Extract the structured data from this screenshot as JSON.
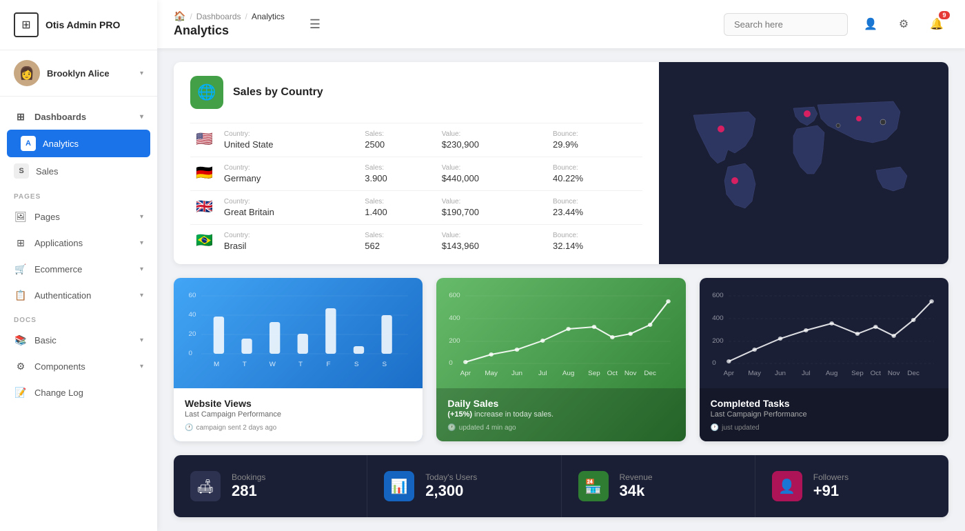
{
  "sidebar": {
    "logo_text": "Otis Admin PRO",
    "user_name": "Brooklyn Alice",
    "nav": {
      "dashboards_label": "Dashboards",
      "analytics_label": "Analytics",
      "analytics_letter": "A",
      "sales_label": "Sales",
      "sales_letter": "S",
      "pages_section": "PAGES",
      "pages_label": "Pages",
      "applications_label": "Applications",
      "ecommerce_label": "Ecommerce",
      "authentication_label": "Authentication",
      "docs_section": "DOCS",
      "basic_label": "Basic",
      "components_label": "Components",
      "changelog_label": "Change Log"
    }
  },
  "header": {
    "home_icon": "🏠",
    "breadcrumb_sep1": "/",
    "breadcrumb_dashboards": "Dashboards",
    "breadcrumb_sep2": "/",
    "breadcrumb_current": "Analytics",
    "page_title": "Analytics",
    "search_placeholder": "Search here",
    "notif_count": "9"
  },
  "sales_by_country": {
    "title": "Sales by Country",
    "columns": {
      "country": "Country:",
      "sales": "Sales:",
      "value": "Value:",
      "bounce": "Bounce:"
    },
    "rows": [
      {
        "flag": "🇺🇸",
        "country": "United State",
        "sales": "2500",
        "value": "$230,900",
        "bounce": "29.9%"
      },
      {
        "flag": "🇩🇪",
        "country": "Germany",
        "sales": "3.900",
        "value": "$440,000",
        "bounce": "40.22%"
      },
      {
        "flag": "🇬🇧",
        "country": "Great Britain",
        "sales": "1.400",
        "value": "$190,700",
        "bounce": "23.44%"
      },
      {
        "flag": "🇧🇷",
        "country": "Brasil",
        "sales": "562",
        "value": "$143,960",
        "bounce": "32.14%"
      }
    ]
  },
  "website_views": {
    "title": "Website Views",
    "subtitle": "Last Campaign Performance",
    "footer": "campaign sent 2 days ago",
    "bars": [
      40,
      15,
      35,
      20,
      55,
      10,
      45
    ],
    "labels": [
      "M",
      "T",
      "W",
      "T",
      "F",
      "S",
      "S"
    ],
    "y_labels": [
      "0",
      "20",
      "40",
      "60"
    ]
  },
  "daily_sales": {
    "title": "Daily Sales",
    "highlight": "(+15%)",
    "subtitle": " increase in today sales.",
    "footer": "updated 4 min ago",
    "data": [
      10,
      50,
      120,
      200,
      280,
      320,
      200,
      250,
      310,
      480
    ],
    "labels": [
      "Apr",
      "May",
      "Jun",
      "Jul",
      "Aug",
      "Sep",
      "Oct",
      "Nov",
      "Dec"
    ],
    "y_labels": [
      "0",
      "200",
      "400",
      "600"
    ]
  },
  "completed_tasks": {
    "title": "Completed Tasks",
    "subtitle": "Last Campaign Performance",
    "footer": "just updated",
    "data": [
      20,
      80,
      180,
      280,
      400,
      280,
      320,
      260,
      360,
      460
    ],
    "labels": [
      "Apr",
      "May",
      "Jun",
      "Jul",
      "Aug",
      "Sep",
      "Oct",
      "Nov",
      "Dec"
    ],
    "y_labels": [
      "0",
      "200",
      "400",
      "600"
    ]
  },
  "stats": [
    {
      "icon": "🛋",
      "icon_class": "dark-icon",
      "label": "Bookings",
      "value": "281"
    },
    {
      "icon": "📊",
      "icon_class": "blue-icon",
      "label": "Today's Users",
      "value": "2,300"
    },
    {
      "icon": "🏪",
      "icon_class": "green-icon",
      "label": "Revenue",
      "value": "34k"
    },
    {
      "icon": "👤",
      "icon_class": "pink-icon",
      "label": "Followers",
      "value": "+91"
    }
  ]
}
